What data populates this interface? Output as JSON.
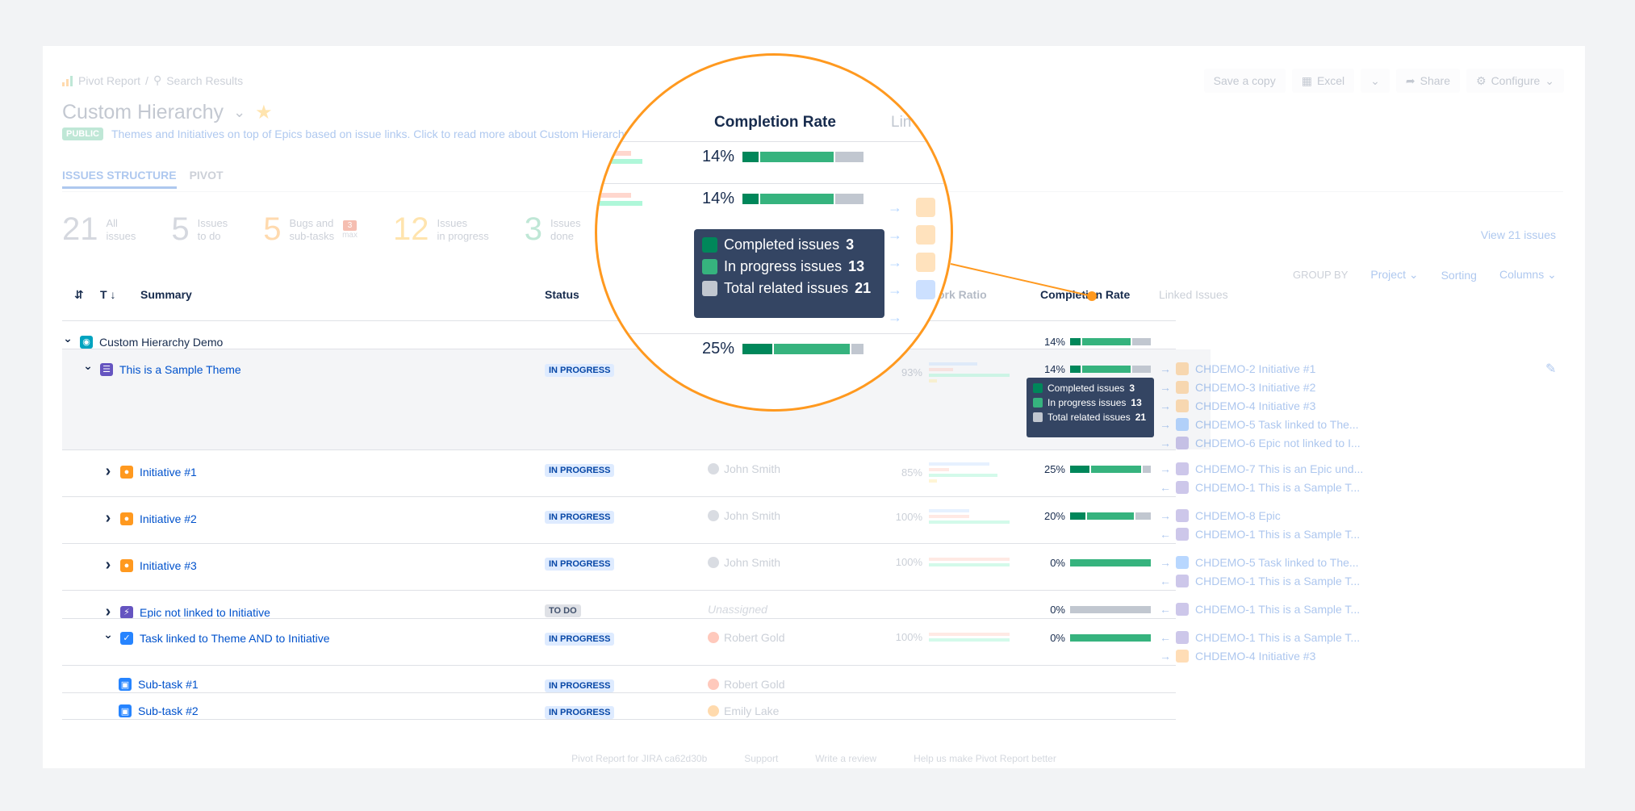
{
  "breadcrumb": {
    "app": "Pivot Report",
    "separator": "/",
    "page": "Search Results"
  },
  "title": "Custom Hierarchy",
  "visibility_badge": "PUBLIC",
  "description": "Themes and Initiatives on top of Epics based on issue links. Click to read more about Custom Hierarchy",
  "toolbar": {
    "save_copy": "Save a copy",
    "excel": "Excel",
    "share": "Share",
    "configure": "Configure"
  },
  "tabs": {
    "issues_structure": "ISSUES STRUCTURE",
    "pivot": "PIVOT"
  },
  "stats": [
    {
      "number": "21",
      "label1": "All",
      "label2": "issues",
      "color": "#7a869a"
    },
    {
      "number": "5",
      "label1": "Issues",
      "label2": "to do",
      "color": "#7a869a"
    },
    {
      "number": "5",
      "label1": "Bugs and",
      "label2": "sub-tasks",
      "color": "#ff8b00",
      "badge": "3",
      "badge_sub": "max"
    },
    {
      "number": "12",
      "label1": "Issues",
      "label2": "in progress",
      "color": "#ffab00"
    },
    {
      "number": "3",
      "label1": "Issues",
      "label2": "done",
      "color": "#36b37e"
    }
  ],
  "view_all": "View 21 issues",
  "groupby": {
    "label": "GROUP BY",
    "value": "Project",
    "sorting": "Sorting",
    "columns": "Columns"
  },
  "headers": {
    "sort": "T",
    "summary": "Summary",
    "status": "Status",
    "work_ratio": "Work Ratio",
    "completion_rate": "Completion Rate",
    "linked": "Linked Issues"
  },
  "rows": {
    "root": {
      "summary": "Custom Hierarchy Demo",
      "cr_pct": "14%",
      "cr": [
        0.14,
        0.62,
        0.24
      ]
    },
    "theme": {
      "summary": "This is a Sample Theme",
      "status": "IN PROGRESS",
      "wr_pct": "93%",
      "cr_pct": "14%",
      "cr": [
        0.14,
        0.62,
        0.24
      ],
      "links": [
        "CHDEMO-2 Initiative #1",
        "CHDEMO-3 Initiative #2",
        "CHDEMO-4 Initiative #3",
        "CHDEMO-5 Task linked to The...",
        "CHDEMO-6 Epic not linked to I..."
      ]
    },
    "init1": {
      "summary": "Initiative #1",
      "status": "IN PROGRESS",
      "assignee": "John Smith",
      "wr_pct": "85%",
      "cr_pct": "25%",
      "cr": [
        0.25,
        0.65,
        0.1
      ],
      "links": [
        "CHDEMO-7 This is an Epic und...",
        "CHDEMO-1 This is a Sample T..."
      ]
    },
    "init2": {
      "summary": "Initiative #2",
      "status": "IN PROGRESS",
      "assignee": "John Smith",
      "wr_pct": "100%",
      "cr_pct": "20%",
      "cr": [
        0.2,
        0.6,
        0.2
      ],
      "links": [
        "CHDEMO-8 Epic",
        "CHDEMO-1 This is a Sample T..."
      ]
    },
    "init3": {
      "summary": "Initiative #3",
      "status": "IN PROGRESS",
      "assignee": "John Smith",
      "wr_pct": "100%",
      "cr_pct": "0%",
      "cr": [
        0,
        1,
        0
      ],
      "links": [
        "CHDEMO-5 Task linked to The...",
        "CHDEMO-1 This is a Sample T..."
      ]
    },
    "epic": {
      "summary": "Epic not linked to Initiative",
      "status": "TO DO",
      "assignee": "Unassigned",
      "cr_pct": "0%",
      "cr": [
        0,
        0,
        1
      ],
      "links": [
        "CHDEMO-1 This is a Sample T..."
      ]
    },
    "task": {
      "summary": "Task linked to Theme AND to Initiative",
      "status": "IN PROGRESS",
      "assignee": "Robert Gold",
      "wr_pct": "100%",
      "cr_pct": "0%",
      "cr": [
        0,
        1,
        0
      ],
      "links": [
        "CHDEMO-1 This is a Sample T...",
        "CHDEMO-4 Initiative #3"
      ]
    },
    "sub1": {
      "summary": "Sub-task #1",
      "status": "IN PROGRESS",
      "assignee": "Robert Gold"
    },
    "sub2": {
      "summary": "Sub-task #2",
      "status": "IN PROGRESS",
      "assignee": "Emily Lake"
    }
  },
  "tooltip": {
    "completed_label": "Completed issues",
    "completed": "3",
    "inprogress_label": "In progress issues",
    "inprogress": "13",
    "total_label": "Total related issues",
    "total": "21"
  },
  "magnifier": {
    "header": "Completion Rate",
    "header_next": "Lin",
    "rows": [
      {
        "pct": "14%",
        "cr": [
          0.14,
          0.62,
          0.24
        ]
      },
      {
        "pct": "14%",
        "cr": [
          0.14,
          0.62,
          0.24
        ]
      },
      {
        "pct": "25%",
        "cr": [
          0.25,
          0.65,
          0.1
        ]
      }
    ]
  },
  "footer": [
    "Pivot Report for JIRA ca62d30b",
    "Support",
    "Write a review",
    "Help us make Pivot Report better"
  ],
  "colors": {
    "completed": "#00875a",
    "in_progress": "#36b37e",
    "total": "#c1c7d0",
    "accent": "#ff991f",
    "link": "#0052cc"
  }
}
